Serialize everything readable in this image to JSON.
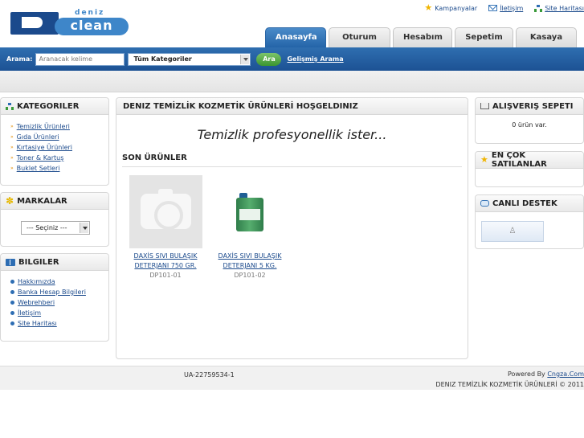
{
  "header": {
    "logo_text": "clean",
    "logo_small": "deniz",
    "top_links": {
      "campaigns": "Kampanyalar",
      "contact": "İletişim",
      "sitemap": "Site Haritası"
    },
    "tabs": [
      "Anasayfa",
      "Oturum Aç",
      "Hesabım",
      "Sepetim",
      "Kasaya Git"
    ],
    "active_tab": "Anasayfa"
  },
  "search": {
    "label": "Arama:",
    "placeholder": "Aranacak kelime",
    "category_selected": "Tüm Kategoriler",
    "button_label": "Ara",
    "advanced_link": "Gelişmiş Arama"
  },
  "sidebar_left": {
    "categories": {
      "title": "KATEGORILER",
      "items": [
        "Temizlik Ürünleri",
        "Gıda Ürünleri",
        "Kırtasiye Ürünleri",
        "Toner & Kartuş",
        "Buklet Setleri"
      ]
    },
    "brands": {
      "title": "MARKALAR",
      "select_value": "--- Seçiniz ---"
    },
    "info": {
      "title": "BILGILER",
      "items": [
        "Hakkımızda",
        "Banka Hesap Bilgileri",
        "Webrehberi",
        "İletişim",
        "Site Haritası"
      ]
    }
  },
  "main": {
    "title": "DENIZ TEMİZLİK KOZMETİK ÜRÜNLERİ HOŞGELDINIZ",
    "slogan": "Temizlik profesyonellik ister...",
    "recent_heading": "SON ÜRÜNLER",
    "products": [
      {
        "name_line1": "DAXİS SIVI BULAŞIK",
        "name_line2": "DETERJANI 750 GR.",
        "code": "DP101-01",
        "image": "no-image-camera-icon"
      },
      {
        "name_line1": "DAXİS SIVI BULAŞIK",
        "name_line2": "DETERJANI 5 KG.",
        "code": "DP101-02",
        "image": "green-jerrycan"
      }
    ]
  },
  "sidebar_right": {
    "cart": {
      "title": "ALIŞVERIŞ SEPETI",
      "status": "0 ürün var."
    },
    "bestsellers": {
      "title": "EN ÇOK SATILANLAR"
    },
    "support": {
      "title": "CANLI DESTEK",
      "button_glyph": "♙"
    }
  },
  "footer": {
    "code": "UA-22759534-1",
    "powered_prefix": "Powered By ",
    "powered_link": "Cngza.Com",
    "copyright": "DENIZ TEMİZLİK KOZMETİK ÜRÜNLERİ © 2011"
  },
  "colors": {
    "brand_blue": "#1c5294",
    "link": "#1b4a8c",
    "search_button": "#3b9430"
  }
}
